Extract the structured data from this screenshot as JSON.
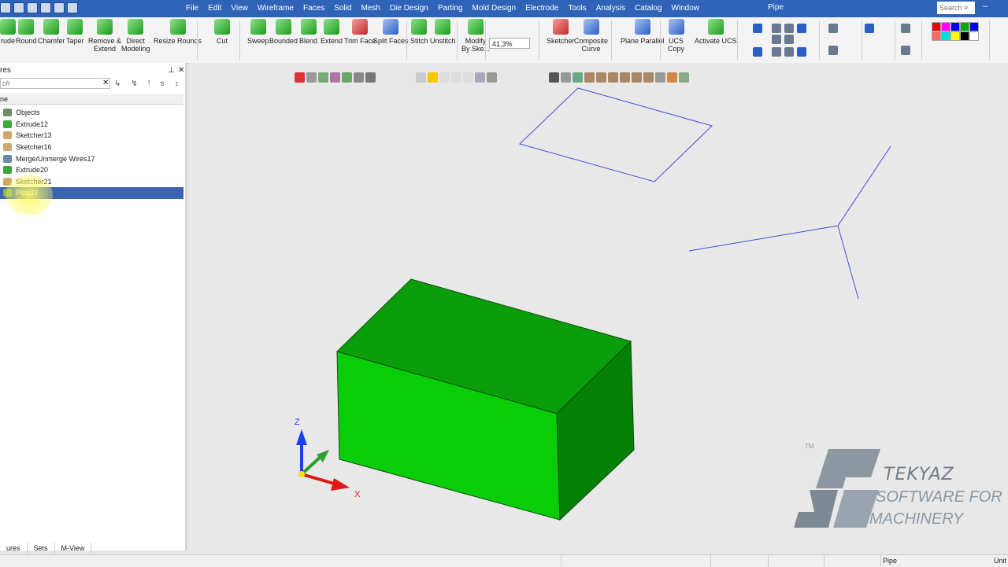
{
  "titlebar": {
    "menu": [
      "File",
      "Edit",
      "View",
      "Wireframe",
      "Faces",
      "Solid",
      "Mesh",
      "Die Design",
      "Parting",
      "Mold Design",
      "Electrode",
      "Tools",
      "Analysis",
      "Catalog",
      "Window"
    ],
    "app_title": "Pipe",
    "search_placeholder": "Search"
  },
  "ribbon": {
    "buttons": [
      {
        "label": "rude",
        "icon": "extrude-icon"
      },
      {
        "label": "Round",
        "icon": "round-icon"
      },
      {
        "label": "Chamfer",
        "icon": "chamfer-icon"
      },
      {
        "label": "Taper",
        "icon": "taper-icon"
      },
      {
        "label": "Remove &\nExtend",
        "icon": "remove-extend-icon"
      },
      {
        "label": "Direct\nModeling",
        "icon": "direct-modeling-icon"
      },
      {
        "label": "Resize Rounds",
        "icon": "resize-rounds-icon"
      },
      {
        "label": "Cut",
        "icon": "cut-icon"
      },
      {
        "label": "Sweep",
        "icon": "sweep-icon"
      },
      {
        "label": "Bounded",
        "icon": "bounded-icon"
      },
      {
        "label": "Blend",
        "icon": "blend-icon"
      },
      {
        "label": "Extend",
        "icon": "extend-icon"
      },
      {
        "label": "Trim Face",
        "icon": "trim-face-icon"
      },
      {
        "label": "Split Faces",
        "icon": "split-faces-icon"
      },
      {
        "label": "Stitch",
        "icon": "stitch-icon"
      },
      {
        "label": "Unstitch",
        "icon": "unstitch-icon"
      },
      {
        "label": "Modify\nBy Ske...",
        "icon": "modify-by-sketch-icon"
      },
      {
        "label": "Sketcher",
        "icon": "sketcher-icon"
      },
      {
        "label": "Composite\nCurve",
        "icon": "composite-curve-icon"
      },
      {
        "label": "Plane Parallel",
        "icon": "plane-parallel-icon"
      },
      {
        "label": "UCS\nCopy",
        "icon": "ucs-copy-icon"
      },
      {
        "label": "Activate UCS",
        "icon": "activate-ucs-icon"
      }
    ],
    "zoom": "41,3%"
  },
  "panel": {
    "title": "res",
    "search_placeholder": "ch",
    "column_header": "ne",
    "items": [
      {
        "label": "Objects",
        "icon": "objects-icon"
      },
      {
        "label": "Extrude12",
        "icon": "extrude-feature-icon"
      },
      {
        "label": "Sketcher13",
        "icon": "sketch-feature-icon"
      },
      {
        "label": "Sketcher16",
        "icon": "sketch-feature-icon"
      },
      {
        "label": "Merge/Unmerge Wires17",
        "icon": "merge-wires-icon"
      },
      {
        "label": "Extrude20",
        "icon": "extrude-feature-icon"
      },
      {
        "label": "Sketcher21",
        "icon": "sketch-feature-icon"
      },
      {
        "label": "Pipe23",
        "icon": "pipe-feature-icon"
      }
    ],
    "tabs": [
      "ures",
      "Sets",
      "M-View"
    ]
  },
  "viewport": {
    "axes": {
      "z": "Z",
      "x": "X"
    }
  },
  "logo": {
    "trademark": "TM",
    "name": "TEKYAZ",
    "tagline1": "SOFTWARE FOR",
    "tagline2": "MACHINERY"
  },
  "status": {
    "document": "Pipe",
    "units": "Unit"
  },
  "colors": {
    "title_bar": "#2f63b8",
    "selection": "#3a63b0",
    "box_top": "#0b9e0b",
    "box_front": "#0acd0a",
    "box_side": "#058205",
    "wire": "#4a4ad6"
  }
}
